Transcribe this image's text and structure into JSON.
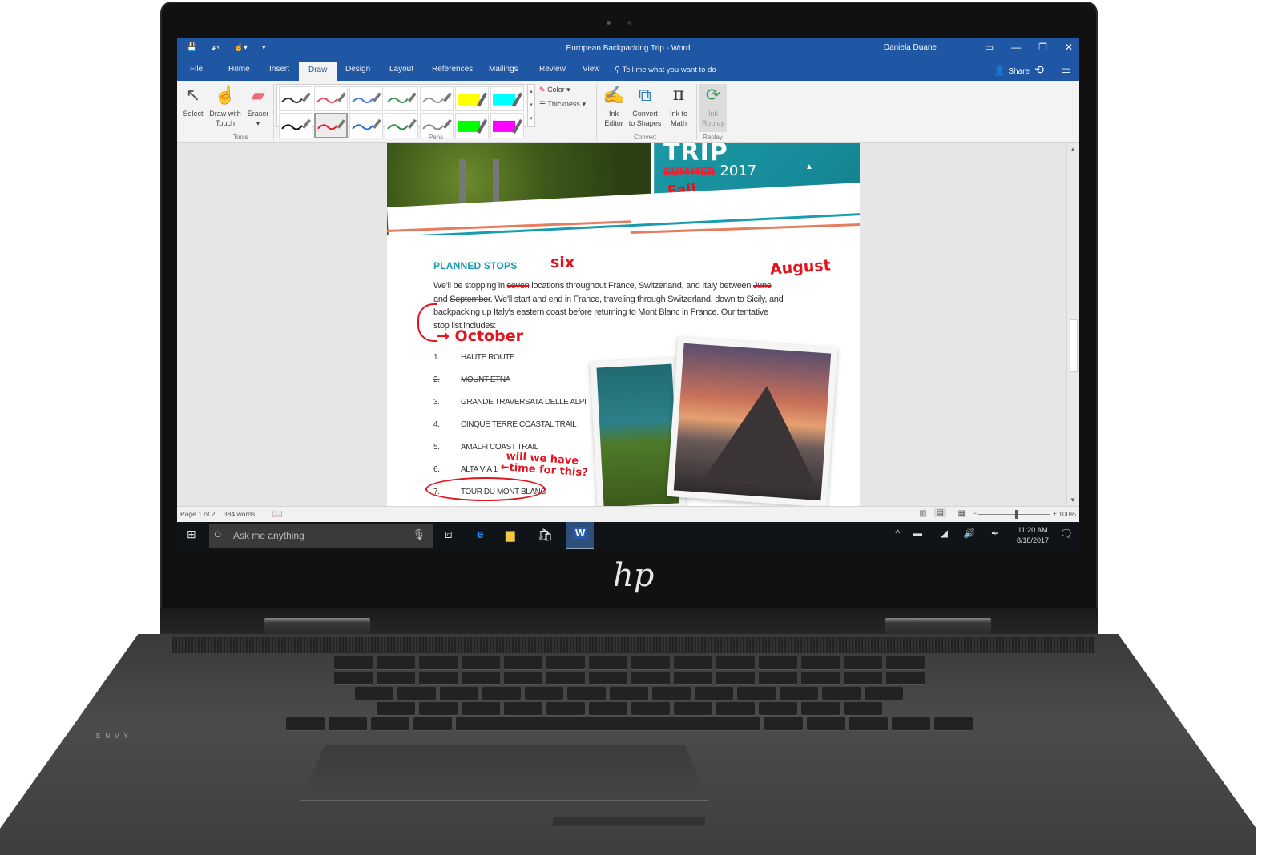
{
  "titlebar": {
    "doc_title": "European Backpacking Trip - Word",
    "user": "Daniela Duane",
    "qat": {
      "save": "💾",
      "undo": "↶",
      "touch_mode": "☝▾",
      "customize": "▾"
    },
    "controls": {
      "ribbon_display": "▭",
      "minimize": "—",
      "restore": "❐",
      "close": "✕"
    }
  },
  "tabs": [
    "File",
    "Home",
    "Insert",
    "Draw",
    "Design",
    "Layout",
    "References",
    "Mailings",
    "Review",
    "View"
  ],
  "active_tab": "Draw",
  "tell_me": "Tell me what you want to do",
  "share": "Share",
  "ribbon": {
    "tools": {
      "label": "Tools",
      "select": "Select",
      "draw_with_touch_1": "Draw with",
      "draw_with_touch_2": "Touch",
      "eraser": "Eraser",
      "eraser_arrow": "▾"
    },
    "pens": {
      "label": "Pens",
      "items": [
        {
          "color": "#333333",
          "type": "pen"
        },
        {
          "color": "#e8505a",
          "type": "pen"
        },
        {
          "color": "#4a7fd0",
          "type": "pen"
        },
        {
          "color": "#3a9a5a",
          "type": "pen"
        },
        {
          "color": "#999999",
          "type": "pen"
        },
        {
          "color": "#ffff00",
          "type": "highlighter"
        },
        {
          "color": "#00ffff",
          "type": "highlighter"
        },
        {
          "color": "#111111",
          "type": "pen"
        },
        {
          "color": "#e3141e",
          "type": "pen",
          "selected": true
        },
        {
          "color": "#1f6ad0",
          "type": "pen"
        },
        {
          "color": "#1f8a3a",
          "type": "pen"
        },
        {
          "color": "#888888",
          "type": "pen"
        },
        {
          "color": "#00ff00",
          "type": "highlighter"
        },
        {
          "color": "#ff00ff",
          "type": "highlighter"
        }
      ],
      "color": "Color",
      "thickness": "Thickness"
    },
    "convert": {
      "label": "Convert",
      "ink_editor_1": "Ink",
      "ink_editor_2": "Editor",
      "to_shapes_1": "Convert",
      "to_shapes_2": "to Shapes",
      "ink_math_1": "Ink to",
      "ink_math_2": "Math"
    },
    "replay": {
      "label": "Replay",
      "ink_replay_1": "Ink",
      "ink_replay_2": "Replay"
    }
  },
  "document": {
    "banner": {
      "title": "TRIP",
      "season_struck": "SUMMER",
      "year": "2017",
      "ink_fall": "Fall"
    },
    "section_heading": "PLANNED STOPS",
    "paragraph": {
      "p1": "We'll be stopping in ",
      "struck_seven": "seven",
      "p2": " locations throughout France, Switzerland, and Italy between ",
      "struck_june": "June",
      "p3": " and ",
      "struck_september": "September",
      "p4": ". We'll start and end in France, traveling through Switzerland, down to Sicily, and backpacking up Italy's eastern coast before returning to Mont Blanc in France. Our tentative stop list includes:"
    },
    "ink_annotations": {
      "six": "six",
      "august": "August",
      "october": "October",
      "question_1": "will we have",
      "question_2": "time for this?"
    },
    "stops": [
      {
        "num": "1.",
        "name": "HAUTE ROUTE",
        "crossed": false
      },
      {
        "num": "2.",
        "name": "MOUNT ETNA",
        "crossed": true
      },
      {
        "num": "3.",
        "name": "GRANDE TRAVERSATA DELLE ALPI",
        "crossed": false
      },
      {
        "num": "4.",
        "name": "CINQUE TERRE COASTAL TRAIL",
        "crossed": false
      },
      {
        "num": "5.",
        "name": "AMALFI COAST TRAIL",
        "crossed": false
      },
      {
        "num": "6.",
        "name": "ALTA VIA 1",
        "crossed": false
      },
      {
        "num": "7.",
        "name": "TOUR DU MONT BLANC",
        "crossed": false,
        "circled": true
      }
    ]
  },
  "statusbar": {
    "page": "Page 1 of 2",
    "words": "384 words",
    "zoom": "100%",
    "zoom_minus": "−",
    "zoom_plus": "+"
  },
  "taskbar": {
    "search_placeholder": "Ask me anything",
    "time": "11:20 AM",
    "date": "8/18/2017"
  },
  "device": {
    "brand": "hp",
    "model": "ENVY"
  },
  "colors": {
    "word_blue": "#1f57a5",
    "ink_red": "#e3141e",
    "heading_teal": "#1a9cb0"
  }
}
